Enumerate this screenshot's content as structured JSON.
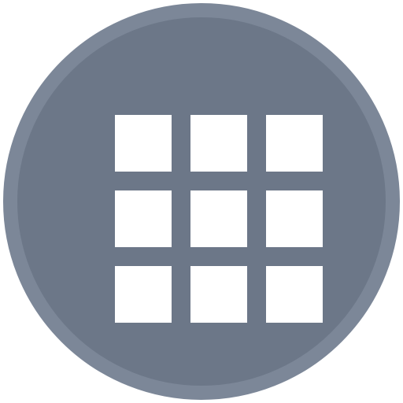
{
  "app_icon": {
    "label": "",
    "icon": "grid-3x3-icon",
    "colors": {
      "rim": "#7c8798",
      "face": "#6c7788",
      "tiles": "#ffffff"
    }
  }
}
